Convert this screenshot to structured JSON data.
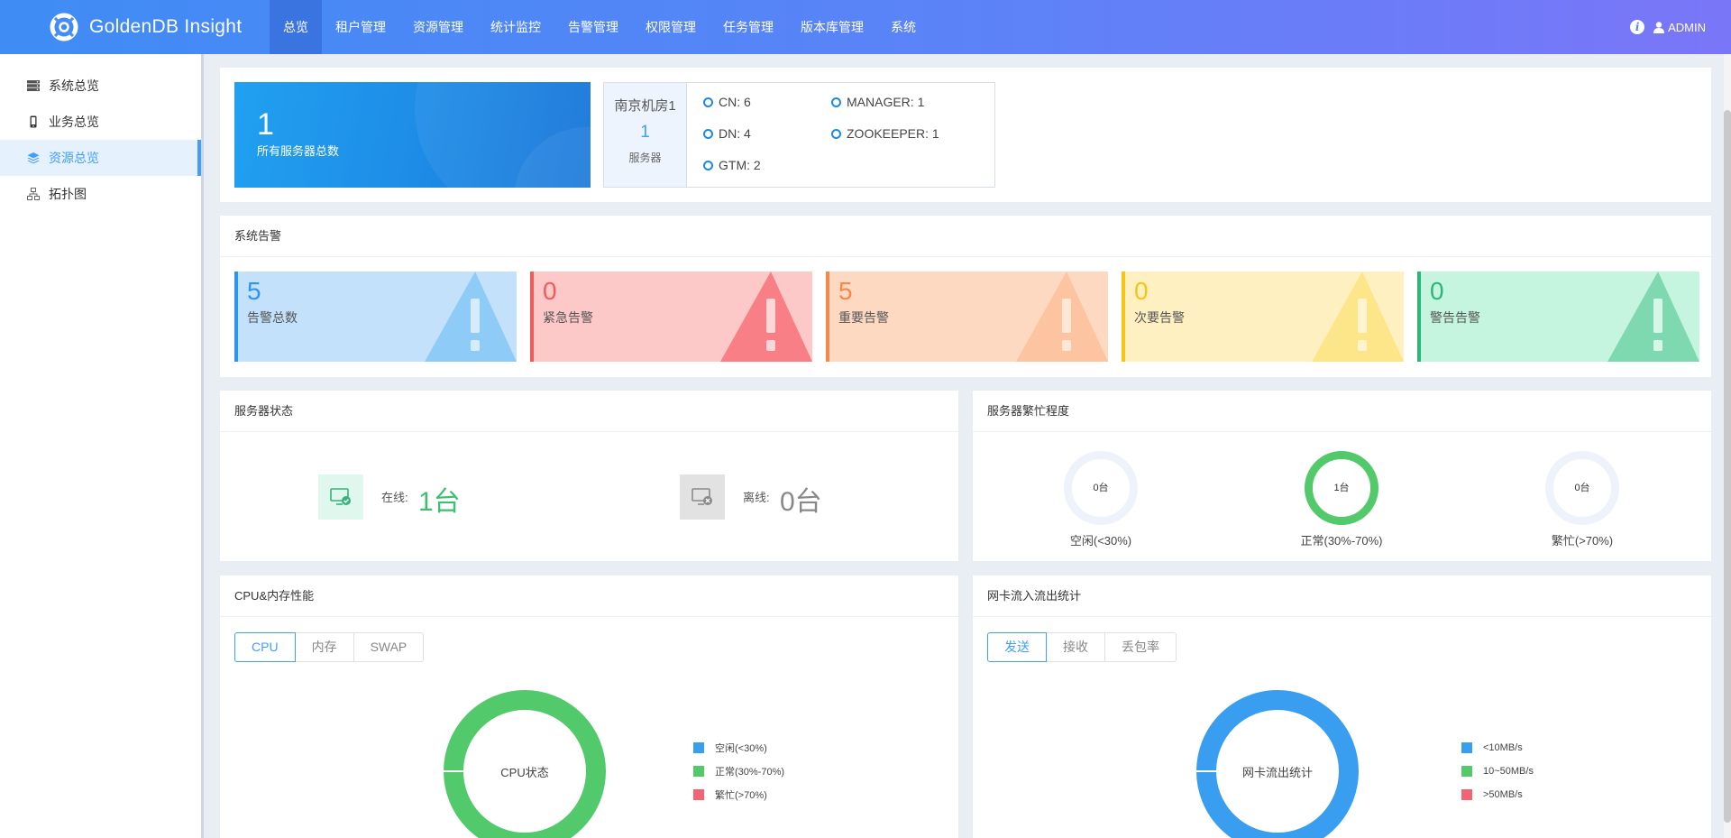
{
  "app": {
    "title": "GoldenDB Insight"
  },
  "nav": {
    "items": [
      {
        "label": "总览",
        "active": true
      },
      {
        "label": "租户管理"
      },
      {
        "label": "资源管理"
      },
      {
        "label": "统计监控"
      },
      {
        "label": "告警管理"
      },
      {
        "label": "权限管理"
      },
      {
        "label": "任务管理"
      },
      {
        "label": "版本库管理"
      },
      {
        "label": "系统"
      }
    ]
  },
  "header": {
    "info_glyph": "i",
    "user": "ADMIN"
  },
  "sidebar": {
    "items": [
      {
        "label": "系统总览",
        "icon": "server-list-icon"
      },
      {
        "label": "业务总览",
        "icon": "phone-icon"
      },
      {
        "label": "资源总览",
        "icon": "layers-icon",
        "active": true
      },
      {
        "label": "拓扑图",
        "icon": "topology-icon"
      }
    ]
  },
  "overview": {
    "total_servers": "1",
    "total_label": "所有服务器总数",
    "room": {
      "name": "南京机房1",
      "count": "1",
      "unit": "服务器",
      "components": [
        "CN: 6",
        "DN: 4",
        "GTM: 2",
        "MANAGER: 1",
        "ZOOKEEPER: 1"
      ]
    }
  },
  "alarms": {
    "title": "系统告警",
    "cards": [
      {
        "value": "5",
        "label": "告警总数",
        "color": "#409eff"
      },
      {
        "value": "0",
        "label": "紧急告警",
        "color": "#f56c6c"
      },
      {
        "value": "5",
        "label": "重要告警",
        "color": "#f5884a"
      },
      {
        "value": "0",
        "label": "次要告警",
        "color": "#f5c518"
      },
      {
        "value": "0",
        "label": "警告告警",
        "color": "#3dbd82"
      }
    ]
  },
  "server_status": {
    "title": "服务器状态",
    "online_label": "在线:",
    "online_value": "1台",
    "offline_label": "离线:",
    "offline_value": "0台"
  },
  "busy": {
    "title": "服务器繁忙程度",
    "rings": [
      {
        "value": "0台",
        "label": "空闲(<30%)",
        "color": "#eef2fb"
      },
      {
        "value": "1台",
        "label": "正常(30%-70%)",
        "color": "#52c96b"
      },
      {
        "value": "0台",
        "label": "繁忙(>70%)",
        "color": "#eef2fb"
      }
    ]
  },
  "cpu_mem": {
    "title": "CPU&内存性能",
    "tabs": [
      "CPU",
      "内存",
      "SWAP"
    ],
    "chart_center": "CPU状态",
    "legend": [
      {
        "label": "空闲(<30%)",
        "color": "#3a9ef0"
      },
      {
        "label": "正常(30%-70%)",
        "color": "#52c96b"
      },
      {
        "label": "繁忙(>70%)",
        "color": "#f06474"
      }
    ]
  },
  "network": {
    "title": "网卡流入流出统计",
    "tabs": [
      "发送",
      "接收",
      "丢包率"
    ],
    "chart_center": "网卡流出统计",
    "legend": [
      {
        "label": "<10MB/s",
        "color": "#3a9ef0"
      },
      {
        "label": "10~50MB/s",
        "color": "#52c96b"
      },
      {
        "label": ">50MB/s",
        "color": "#f06474"
      }
    ]
  }
}
